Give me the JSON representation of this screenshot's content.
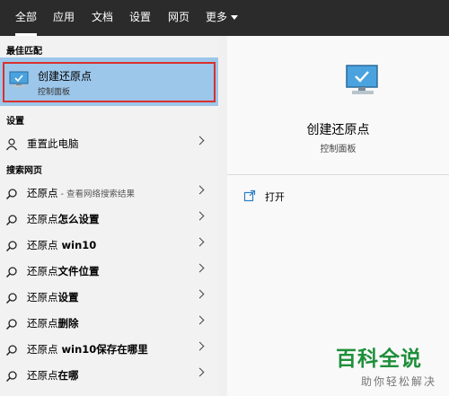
{
  "tabs": [
    {
      "label": "全部",
      "active": true
    },
    {
      "label": "应用"
    },
    {
      "label": "文档"
    },
    {
      "label": "设置"
    },
    {
      "label": "网页"
    },
    {
      "label": "更多"
    }
  ],
  "sections": {
    "best_match": "最佳匹配",
    "settings": "设置",
    "web_search": "搜索网页"
  },
  "best_match": {
    "title": "创建还原点",
    "subtitle": "控制面板",
    "icon": "monitor-check-icon"
  },
  "settings_items": [
    {
      "label": "重置此电脑",
      "icon": "person-icon"
    }
  ],
  "web_items": [
    {
      "prefix": "还原点",
      "bold": "",
      "hint": " - 查看网络搜索结果"
    },
    {
      "prefix": "还原点",
      "bold": "怎么设置",
      "hint": ""
    },
    {
      "prefix": "还原点",
      "bold": " win10",
      "hint": ""
    },
    {
      "prefix": "还原点",
      "bold": "文件位置",
      "hint": ""
    },
    {
      "prefix": "还原点",
      "bold": "设置",
      "hint": ""
    },
    {
      "prefix": "还原点",
      "bold": "删除",
      "hint": ""
    },
    {
      "prefix": "还原点",
      "bold": " win10保存在哪里",
      "hint": ""
    },
    {
      "prefix": "还原点",
      "bold": "在哪",
      "hint": ""
    }
  ],
  "preview": {
    "title": "创建还原点",
    "category": "控制面板",
    "action_label": "打开"
  },
  "watermark": {
    "title": "百科全说",
    "subtitle": "助你轻松解决"
  },
  "colors": {
    "topbar": "#2b2b2b",
    "selected": "#9cc6ea",
    "highlight_border": "#d9302b",
    "watermark": "#1e8f3a"
  }
}
